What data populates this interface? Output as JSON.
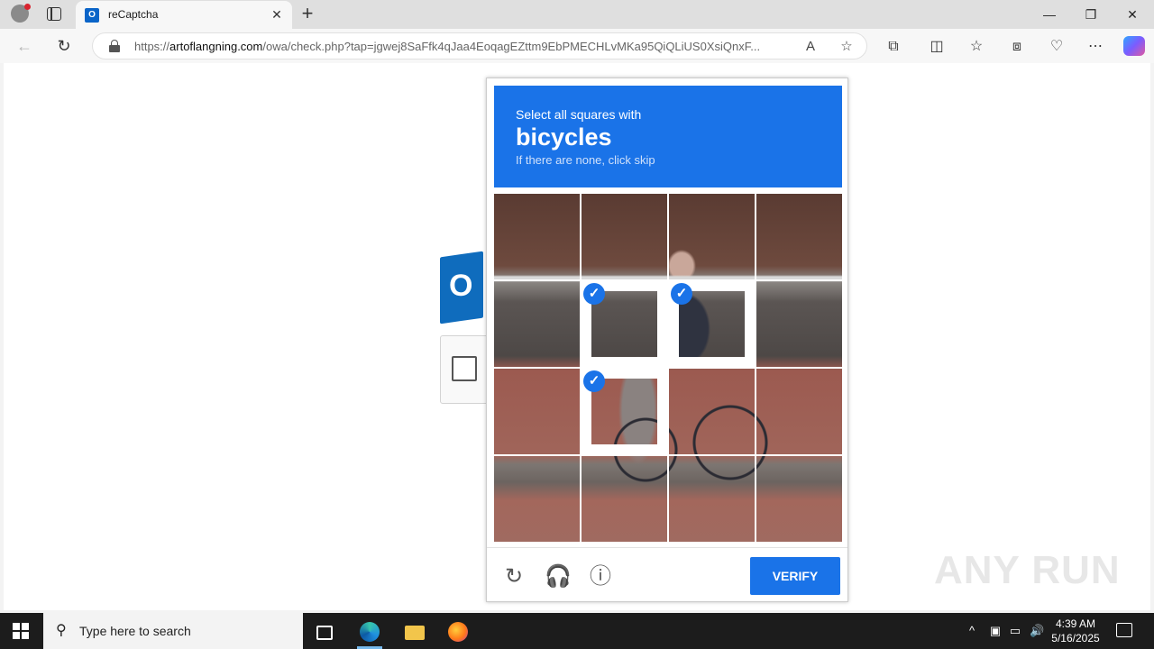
{
  "browser": {
    "tab_title": "reCaptcha",
    "tab_favicon_letter": "O",
    "url_domain": "artoflangning.com",
    "url_prefix": "https://",
    "url_rest": "/owa/check.php?tap=jgwej8SaFfk4qJaa4EoqagEZttm9EbPMECHLvMKa95QiQLiUS0XsiQnxF..."
  },
  "captcha": {
    "instruction_line1": "Select all squares with",
    "target": "bicycles",
    "instruction_line3": "If there are none, click skip",
    "verify_label": "VERIFY",
    "grid_rows": 4,
    "grid_cols": 4,
    "selected_tiles": [
      5,
      6,
      9
    ]
  },
  "page": {
    "outlook_letter": "O"
  },
  "watermark": "ANY RUN",
  "taskbar": {
    "search_placeholder": "Type here to search",
    "time": "4:39 AM",
    "date": "5/16/2025"
  },
  "colors": {
    "accent": "#1a73e8",
    "outlook_blue": "#0f6cbd"
  }
}
